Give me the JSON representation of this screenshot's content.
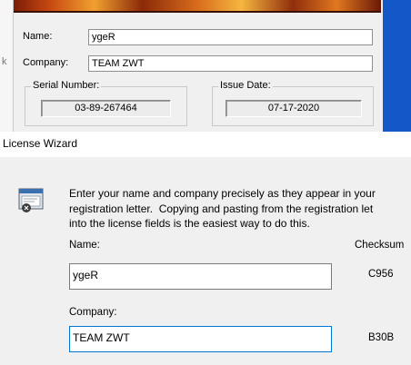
{
  "background_dialog": {
    "left_edge_text": "k",
    "name_label": "Name:",
    "name_value": "ygeR",
    "company_label": "Company:",
    "company_value": "TEAM ZWT",
    "serial_group_title": "Serial Number:",
    "serial_value": "03-89-267464",
    "issue_group_title": "Issue Date:",
    "issue_value": "07-17-2020"
  },
  "wizard": {
    "title": "License Wizard",
    "icon": "license-wizard-icon",
    "intro_lines": [
      "Enter your name and company precisely as they appear in your",
      "registration letter.  Copying and pasting from the registration let",
      "into the license fields is the easiest way to do this."
    ],
    "name_label": "Name:",
    "name_value": "ygeR",
    "checksum_header": "Checksum",
    "name_checksum": "C956",
    "company_label": "Company:",
    "company_value": "TEAM ZWT",
    "company_checksum": "B30B"
  },
  "colors": {
    "desktop_blue": "#1458c8",
    "focus_border": "#0078d7"
  }
}
